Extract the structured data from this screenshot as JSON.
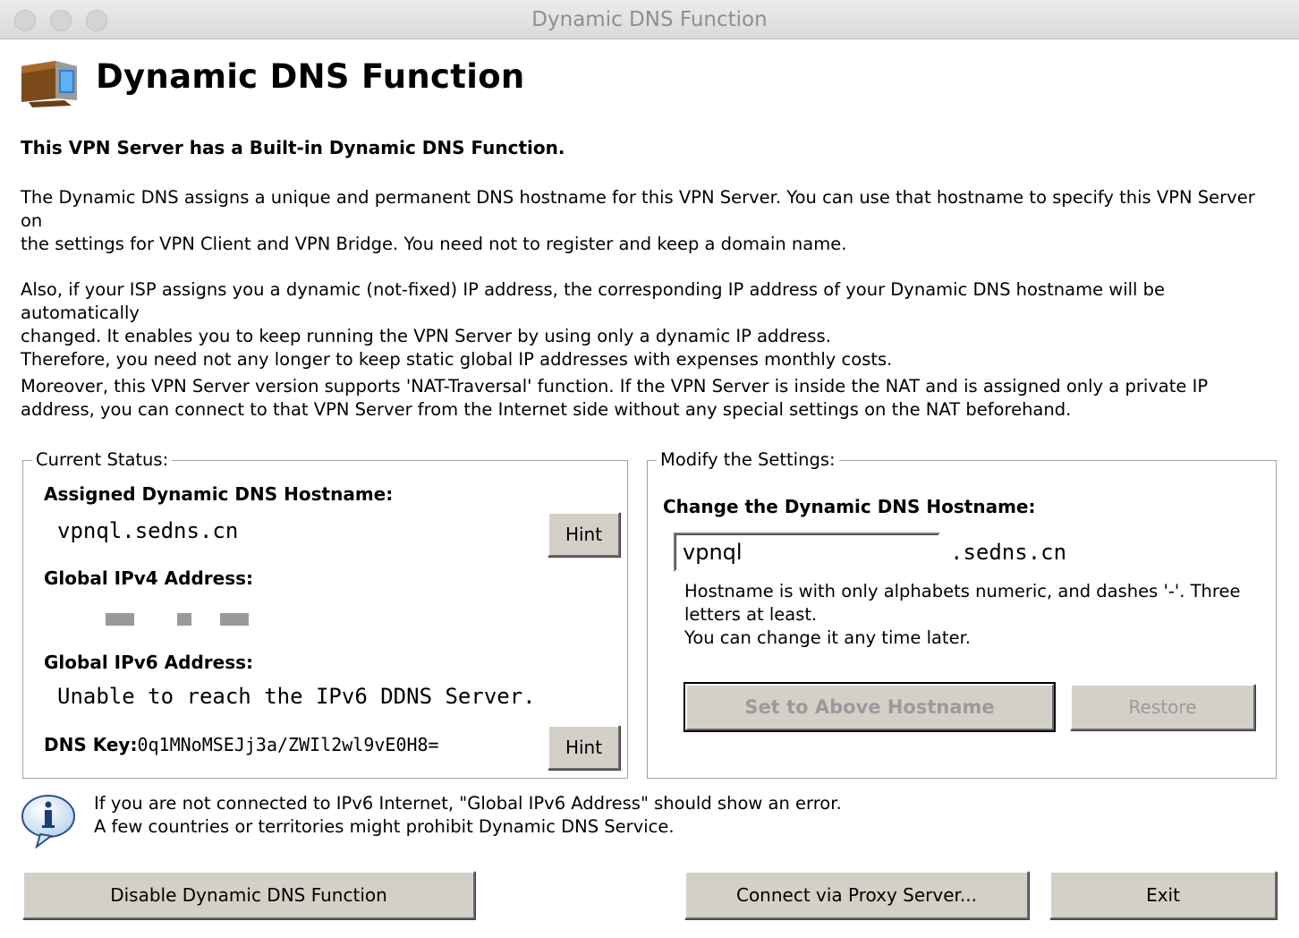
{
  "window": {
    "title": "Dynamic DNS Function"
  },
  "header": {
    "title": "Dynamic DNS Function",
    "icon": "computer-monitor-icon"
  },
  "intro": {
    "lead": "This VPN Server has a Built-in Dynamic DNS Function.",
    "p1": "The Dynamic DNS assigns a unique and permanent DNS hostname for this VPN Server. You can use that hostname to specify this VPN Server on\nthe settings for VPN Client and VPN Bridge. You need not to register and keep a domain name.",
    "p2": "Also, if your ISP assigns you a dynamic (not-fixed) IP address, the corresponding IP address of your Dynamic DNS hostname will be automatically\nchanged. It enables you to keep running the VPN Server by using only a dynamic IP address.\nTherefore, you need not any longer to keep static global IP addresses with expenses monthly costs.",
    "p3": "Moreover, this VPN Server version supports 'NAT-Traversal' function. If the VPN Server is inside the NAT and is assigned only a private IP\naddress, you can connect to that VPN Server from the Internet side without any special settings on the NAT beforehand."
  },
  "status": {
    "legend": "Current Status:",
    "hostname_label": "Assigned Dynamic DNS Hostname:",
    "hostname_value": "vpnql.sedns.cn",
    "hint_label": "Hint",
    "ipv4_label": "Global IPv4 Address:",
    "ipv6_label": "Global IPv6 Address:",
    "ipv6_value": "Unable to reach the IPv6 DDNS Server.",
    "dnskey_label": "DNS Key:",
    "dnskey_value": "0q1MNoMSEJj3a/ZWIl2wl9vE0H8=",
    "hint2_label": "Hint"
  },
  "modify": {
    "legend": "Modify the Settings:",
    "change_label": "Change the Dynamic DNS Hostname:",
    "hostname_input": "vpnql",
    "suffix": ".sedns.cn",
    "note": "Hostname is with only alphabets numeric, and dashes '-'. Three\nletters at least.\nYou can change it any time later.",
    "set_button": "Set to Above Hostname",
    "restore_button": "Restore"
  },
  "info": {
    "icon": "info-speech-bubble-icon",
    "line1": "If you are not connected to IPv6 Internet, \"Global IPv6 Address\" should show an error.",
    "line2": "A few countries or territories might prohibit Dynamic DNS Service."
  },
  "footer": {
    "disable_button": "Disable Dynamic DNS Function",
    "proxy_button": "Connect via Proxy Server...",
    "exit_button": "Exit"
  }
}
